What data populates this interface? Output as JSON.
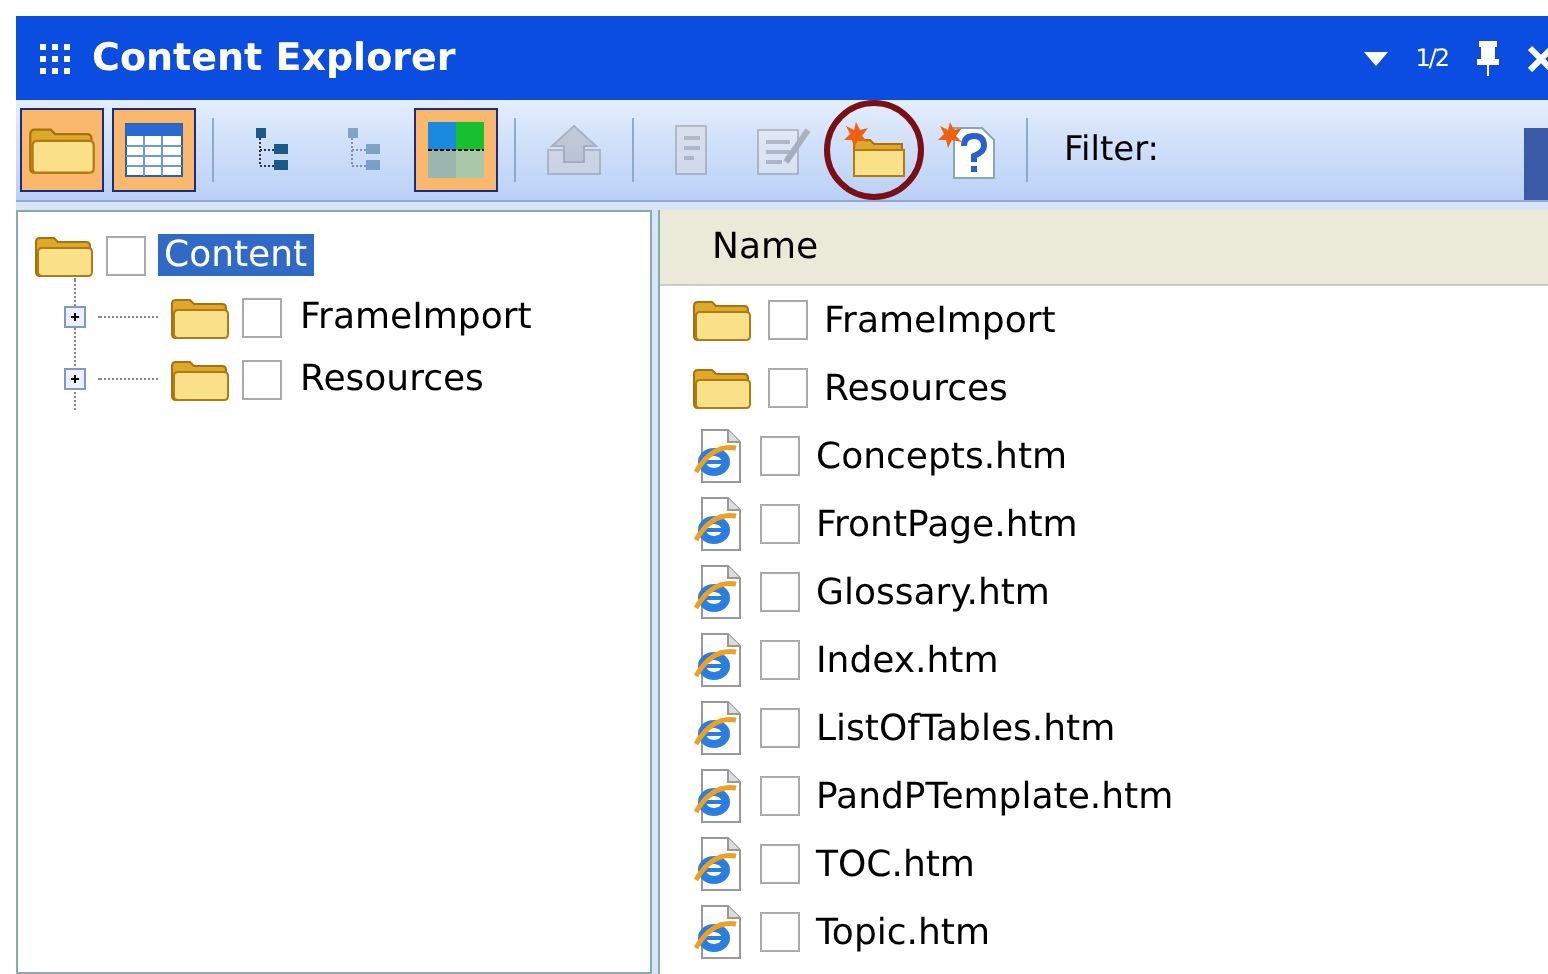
{
  "window": {
    "title": "Content Explorer",
    "page_indicator": "1/2"
  },
  "toolbar": {
    "items": [
      {
        "kind": "open-folder",
        "pressed": true,
        "disabled": false
      },
      {
        "kind": "table",
        "pressed": true,
        "disabled": false
      },
      {
        "kind": "separator"
      },
      {
        "kind": "tree",
        "pressed": false,
        "disabled": false
      },
      {
        "kind": "tree",
        "pressed": false,
        "disabled": true
      },
      {
        "kind": "grid",
        "pressed": true,
        "disabled": false
      },
      {
        "kind": "separator"
      },
      {
        "kind": "upload",
        "pressed": false,
        "disabled": true
      },
      {
        "kind": "separator"
      },
      {
        "kind": "page",
        "pressed": false,
        "disabled": true
      },
      {
        "kind": "edit",
        "pressed": false,
        "disabled": true
      },
      {
        "kind": "new-folder",
        "pressed": false,
        "disabled": false,
        "circled": true
      },
      {
        "kind": "help",
        "pressed": false,
        "disabled": false
      },
      {
        "kind": "separator"
      }
    ],
    "filter_label": "Filter:"
  },
  "tree": [
    {
      "label": "Content",
      "selected": true,
      "checked": false,
      "expanded": true,
      "children": [
        {
          "label": "FrameImport",
          "selected": false,
          "checked": false,
          "expanded": false
        },
        {
          "label": "Resources",
          "selected": false,
          "checked": false,
          "expanded": false
        }
      ]
    }
  ],
  "file_list": {
    "columns": [
      "Name"
    ],
    "rows": [
      {
        "kind": "folder",
        "name": "FrameImport",
        "checked": false
      },
      {
        "kind": "folder",
        "name": "Resources",
        "checked": false
      },
      {
        "kind": "html",
        "name": "Concepts.htm",
        "checked": false
      },
      {
        "kind": "html",
        "name": "FrontPage.htm",
        "checked": false
      },
      {
        "kind": "html",
        "name": "Glossary.htm",
        "checked": false
      },
      {
        "kind": "html",
        "name": "Index.htm",
        "checked": false
      },
      {
        "kind": "html",
        "name": "ListOfTables.htm",
        "checked": false
      },
      {
        "kind": "html",
        "name": "PandPTemplate.htm",
        "checked": false
      },
      {
        "kind": "html",
        "name": "TOC.htm",
        "checked": false
      },
      {
        "kind": "html",
        "name": "Topic.htm",
        "checked": false
      }
    ]
  }
}
